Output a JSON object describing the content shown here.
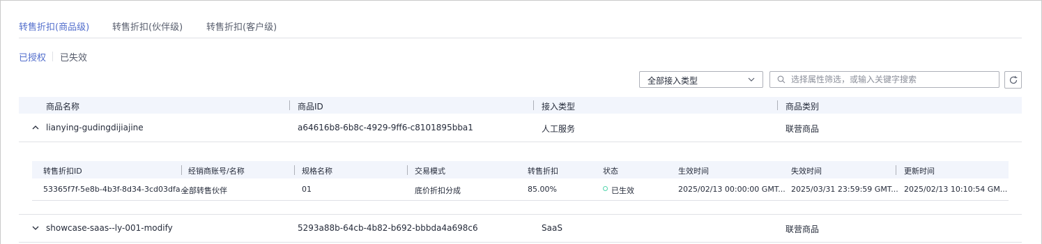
{
  "tabs": [
    {
      "label": "转售折扣(商品级)",
      "active": true
    },
    {
      "label": "转售折扣(伙伴级)",
      "active": false
    },
    {
      "label": "转售折扣(客户级)",
      "active": false
    }
  ],
  "subtabs": [
    {
      "label": "已授权",
      "active": true
    },
    {
      "label": "已失效",
      "active": false
    }
  ],
  "filter": {
    "select_value": "全部接入类型",
    "search_placeholder": "选择属性筛选，或输入关键字搜索"
  },
  "icons": {
    "select_chevron": "chevron-down-icon",
    "search": "search-icon",
    "refresh": "refresh-icon",
    "row_expanded": "chevron-up-icon",
    "row_collapsed": "chevron-down-icon"
  },
  "colors": {
    "accent": "#526ecc",
    "status_active": "#50d4ab",
    "header_bg": "#f2f5fc"
  },
  "table": {
    "columns": [
      "商品名称",
      "商品ID",
      "接入类型",
      "商品类别"
    ],
    "rows": [
      {
        "name": "lianying-gudingdijiajine",
        "id": "a64616b8-6b8c-4929-9ff6-c8101895bba1",
        "access_type": "人工服务",
        "category": "联营商品",
        "expanded": true
      },
      {
        "name": "showcase-saas--ly-001-modify",
        "id": "5293a88b-64cb-4b82-b692-bbbda4a698c6",
        "access_type": "SaaS",
        "category": "联营商品",
        "expanded": false
      }
    ]
  },
  "nested": {
    "columns": [
      "转售折扣ID",
      "经销商账号/名称",
      "规格名称",
      "交易模式",
      "转售折扣",
      "状态",
      "生效时间",
      "失效时间",
      "更新时间"
    ],
    "row": {
      "discount_id": "53365f7f-5e8b-4b3f-8d34-3cd03dfa...",
      "reseller": "全部转售伙伴",
      "spec": "01",
      "trade_mode": "底价折扣分成",
      "discount": "85.00%",
      "status": "已生效",
      "effective_time": "2025/02/13 00:00:00 GMT...",
      "expire_time": "2025/03/31 23:59:59 GMT...",
      "update_time": "2025/02/13 10:10:54 GM..."
    }
  }
}
